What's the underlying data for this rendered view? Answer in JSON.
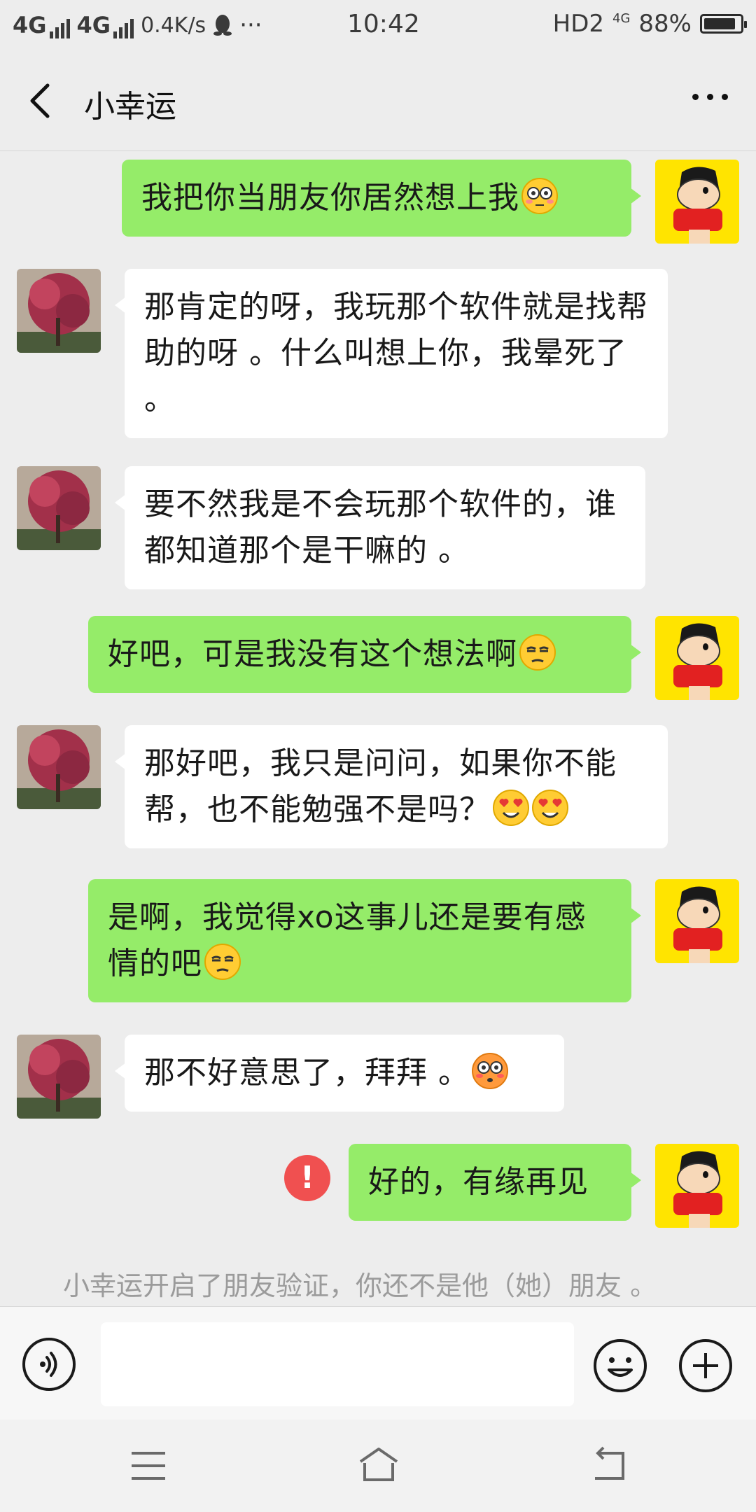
{
  "status_bar": {
    "net1": "4G",
    "net2": "4G",
    "speed": "0.4K/s",
    "dots": "···",
    "time": "10:42",
    "hd": "HD2",
    "small_4g": "4G",
    "battery": "88%",
    "battery_level": 0.88
  },
  "header": {
    "title": "小幸运"
  },
  "messages": [
    {
      "side": "out",
      "text": "我把你当朋友你居然想上我",
      "emoji": "flushed-face"
    },
    {
      "side": "in",
      "text": "那肯定的呀，我玩那个软件就是找帮助的呀 。什么叫想上你，我晕死了 。"
    },
    {
      "side": "in",
      "text": "要不然我是不会玩那个软件的，谁都知道那个是干嘛的 。"
    },
    {
      "side": "out",
      "text": "好吧，可是我没有这个想法啊",
      "emoji": "unamused-face"
    },
    {
      "side": "in",
      "text": "那好吧，我只是问问，如果你不能帮，也不能勉强不是吗？",
      "emoji": "heart-eyes-face"
    },
    {
      "side": "out",
      "text": "是啊，我觉得xo这事儿还是要有感情的吧",
      "emoji": "unamused-face"
    },
    {
      "side": "in",
      "text": "那不好意思了，拜拜 。",
      "emoji": "pleading-face"
    },
    {
      "side": "out",
      "text": "好的，有缘再见",
      "failed": true,
      "error_mark": "!"
    }
  ],
  "system_note": "小幸运开启了朋友验证，你还不是他（她）朋友 。",
  "input": {
    "value": ""
  },
  "icons": {
    "back": "chevron-left-icon",
    "more": "more-icon",
    "voice": "voice-icon",
    "emoji": "emoji-icon",
    "plus": "plus-icon",
    "menu": "menu-icon",
    "home": "home-icon",
    "return": "back-arrow-icon"
  }
}
